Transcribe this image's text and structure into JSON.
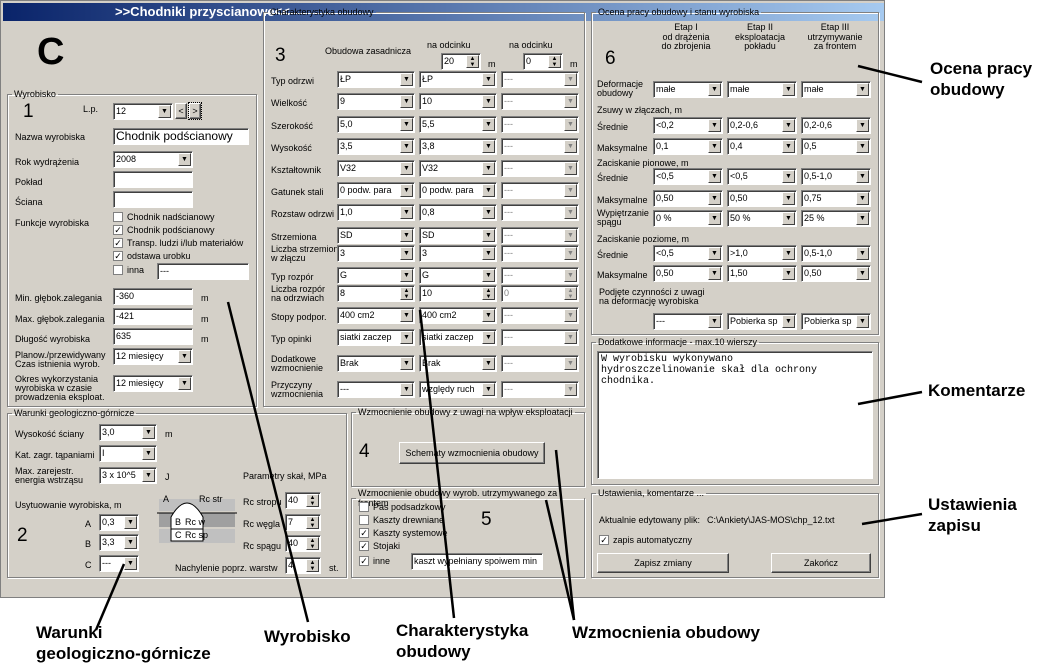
{
  "window": {
    "title": ">>Chodniki przyscianowe<<"
  },
  "section_c": {
    "letter": "C"
  },
  "wyrobisko": {
    "legend": "Wyrobisko",
    "number": "1",
    "lp_label": "L.p.",
    "lp_value": "12",
    "nav_prev": "<",
    "nav_next": ">",
    "nazwa_label": "Nazwa wyrobiska",
    "nazwa_value": "Chodnik podścianowy",
    "rok_label": "Rok wydrążenia",
    "rok_value": "2008",
    "poklad_label": "Pokład",
    "poklad_value": "",
    "sciana_label": "Ściana",
    "sciana_value": "",
    "funkcje_label": "Funkcje wyrobiska",
    "funkcje": [
      {
        "label": "Chodnik nadścianowy",
        "checked": false
      },
      {
        "label": "Chodnik podścianowy",
        "checked": true
      },
      {
        "label": "Transp. ludzi i/lub materiałów",
        "checked": true
      },
      {
        "label": "odstawa urobku",
        "checked": true
      },
      {
        "label": "inna",
        "checked": false
      }
    ],
    "inna_value": "---",
    "min_glebok_label": "Min. głębok.zalegania",
    "min_glebok_value": "-360",
    "min_unit": "m",
    "max_glebok_label": "Max. głębok.zalegania",
    "max_glebok_value": "-421",
    "max_unit": "m",
    "dlugosc_label": "Długość wyrobiska",
    "dlugosc_value": "635",
    "dlugosc_unit": "m",
    "czas_label1": "Planow./przewidywany",
    "czas_label2": "Czas istnienia wyrob.",
    "czas_value": "12 miesięcy",
    "okres_label1": "Okres wykorzystania",
    "okres_label2": "wyrobiska w  czasie",
    "okres_label3": "prowadzenia eksploat.",
    "okres_value": "12 miesięcy"
  },
  "warunki": {
    "legend": "Warunki geologiczno-górnicze",
    "number": "2",
    "wysokosc_label": "Wysokość ściany",
    "wysokosc_value": "3,0",
    "wysokosc_unit": "m",
    "kat_label": "Kat. zagr. tąpaniami",
    "kat_value": "I",
    "max_energia_label1": "Max. zarejestr.",
    "max_energia_label2": "energia wstrząsu",
    "energia_value": "3 x 10^5",
    "energia_unit": "J",
    "usytuowanie_label": "Usytuowanie wyrobiska, m",
    "a_label": "A",
    "a_value": "0,3",
    "b_label": "B",
    "b_value": "3,3",
    "c_label": "C",
    "c_value": "---",
    "diagram_a": "A",
    "diagram_rcstr": "Rc str",
    "diagram_b": "B",
    "diagram_rcw": "Rc w",
    "diagram_c": "C",
    "diagram_rcsp": "Rc sp",
    "parametry_label": "Parametry skał, MPa",
    "rc_stropu_label": "Rc stropu",
    "rc_stropu_value": "40",
    "rc_wegla_label": "Rc węgla",
    "rc_wegla_value": "7",
    "rc_spagu_label": "Rc spągu",
    "rc_spagu_value": "40",
    "nachylenie_label": "Nachylenie poprz. warstw",
    "nachylenie_value": "4",
    "nachylenie_unit": "st."
  },
  "charakterystyka": {
    "legend": "Charakterystyka obudowy",
    "number": "3",
    "obudowa_zasadnicza": "Obudowa zasadnicza",
    "na_odcinku1": "na odcinku",
    "na_odcinku2": "na odcinku",
    "odcinek1_value": "20",
    "odcinek2_value": "0",
    "unit_m": "m",
    "rows": [
      {
        "label": "Typ odrzwi",
        "v1": "ŁP",
        "v2": "ŁP",
        "v3": "---"
      },
      {
        "label": "Wielkość",
        "v1": "9",
        "v2": "10",
        "v3": "---"
      },
      {
        "label": "Szerokość",
        "v1": "5,0",
        "v2": "5,5",
        "v3": "---"
      },
      {
        "label": "Wysokość",
        "v1": "3,5",
        "v2": "3,8",
        "v3": "---"
      },
      {
        "label": "Kształtownik",
        "v1": "V32",
        "v2": "V32",
        "v3": "---"
      },
      {
        "label": "Gatunek stali",
        "v1": "0 podw. para",
        "v2": "0 podw. para",
        "v3": "---"
      },
      {
        "label": "Rozstaw odrzwi",
        "v1": "1,0",
        "v2": "0,8",
        "v3": "---"
      }
    ],
    "strzemiona_label": "Strzemiona",
    "strzemiona": [
      "SD",
      "SD",
      "---"
    ],
    "liczba_strzemion_label1": "Liczba strzemion",
    "liczba_strzemion_label2": "w złączu",
    "liczba_strzemion": [
      "3",
      "3",
      "---"
    ],
    "typ_rozpor_label": "Typ rozpór",
    "typ_rozpor": [
      "G",
      "G",
      "---"
    ],
    "liczba_rozpor_label1": "Liczba rozpór",
    "liczba_rozpor_label2": "na odrzwiach",
    "liczba_rozpor": [
      "8",
      "10",
      "0"
    ],
    "stopy_label": "Stopy podpor.",
    "stopy": [
      "400 cm2",
      "400 cm2",
      "---"
    ],
    "opinki_label": "Typ opinki",
    "opinki": [
      "siatki zaczep",
      "siatki zaczep",
      "---"
    ],
    "dodatkowe_label1": "Dodatkowe",
    "dodatkowe_label2": "wzmocnienie",
    "dodatkowe": [
      "Brak",
      "Brak",
      "---"
    ],
    "przyczyny_label1": "Przyczyny",
    "przyczyny_label2": "wzmocnienia",
    "przyczyny": [
      "---",
      "względy ruch",
      "---"
    ]
  },
  "wzmocnienie_eksploatacja": {
    "legend": "Wzmocnienie obudowy z uwagi na wpływ eksploatacji",
    "number": "4",
    "button": "Schematy wzmocnienia obudowy"
  },
  "wzmocnienie_utrzymywane": {
    "legend": "Wzmocnienie obudowy wyrob. utrzymywanego za frontem",
    "number": "5",
    "items": [
      {
        "label": "Pas podsadzkowy",
        "checked": false
      },
      {
        "label": "Kaszty drewniane",
        "checked": false
      },
      {
        "label": "Kaszty systemowe",
        "checked": true
      },
      {
        "label": "Stojaki",
        "checked": true
      },
      {
        "label": "inne",
        "checked": true
      }
    ],
    "inne_value": "kaszt wypełniany spoiwem min"
  },
  "ocena": {
    "legend": "Ocena pracy obudowy i stanu wyrobiska",
    "number": "6",
    "etap1": "Etap I",
    "etap1_sub1": "od drążenia",
    "etap1_sub2": "do zbrojenia",
    "etap2": "Etap II",
    "etap2_sub1": "eksploatacja",
    "etap2_sub2": "pokładu",
    "etap3": "Etap III",
    "etap3_sub1": "utrzymywanie",
    "etap3_sub2": "za frontem",
    "deformacje_label1": "Deformacje",
    "deformacje_label2": "obudowy",
    "deformacje": [
      "małe",
      "małe",
      "małe"
    ],
    "zsuwy_label": "Zsuwy w złączach, m",
    "srednie_label": "Średnie",
    "zsuwy_srednie": [
      "<0,2",
      "0,2-0,6",
      "0,2-0,6"
    ],
    "maksymalne_label": "Maksymalne",
    "zsuwy_max": [
      "0,1",
      "0,4",
      "0,5"
    ],
    "zaciskanie_pion_label": "Zaciskanie pionowe, m",
    "pion_srednie": [
      "<0,5",
      "<0,5",
      "0,5-1,0"
    ],
    "pion_max": [
      "0,50",
      "0,50",
      "0,75"
    ],
    "wypietrzanie_label1": "Wypiętrzanie",
    "wypietrzanie_label2": "spągu",
    "wypietrzanie": [
      "0 %",
      "50 %",
      "25 %"
    ],
    "zaciskanie_poz_label": "Zaciskanie poziome, m",
    "poz_srednie": [
      "<0,5",
      ">1,0",
      "0,5-1,0"
    ],
    "poz_max": [
      "0,50",
      "1,50",
      "0,50"
    ],
    "czynnosci_label1": "Podjęte czynności z uwagi",
    "czynnosci_label2": "na deformację wyrobiska",
    "czynnosci": [
      "---",
      "Pobierka sp",
      "Pobierka sp"
    ]
  },
  "dodatkowe_info": {
    "legend": "Dodatkowe informacje - max.10 wierszy",
    "text": "W wyrobisku wykonywano\nhydroszczelinowanie skał dla ochrony\nchodnika."
  },
  "ustawienia": {
    "legend": "Ustawienia, komentarze ...",
    "plik_label": "Aktualnie edytowany plik:",
    "plik_value": "C:\\Ankiety\\JAS-MOS\\chp_12.txt",
    "auto_label": "zapis automatyczny",
    "auto_checked": true,
    "zapisz_button": "Zapisz zmiany",
    "zakoncz_button": "Zakończ"
  },
  "annotations": {
    "ocena": "Ocena pracy\nobudowy",
    "komentarze": "Komentarze",
    "ustawienia": "Ustawienia\nzapisu",
    "warunki": "Warunki\ngeologiczno-górnicze",
    "wyrobisko": "Wyrobisko",
    "charakterystyka": "Charakterystyka\nobudowy",
    "wzmocnienia": "Wzmocnienia obudowy"
  }
}
